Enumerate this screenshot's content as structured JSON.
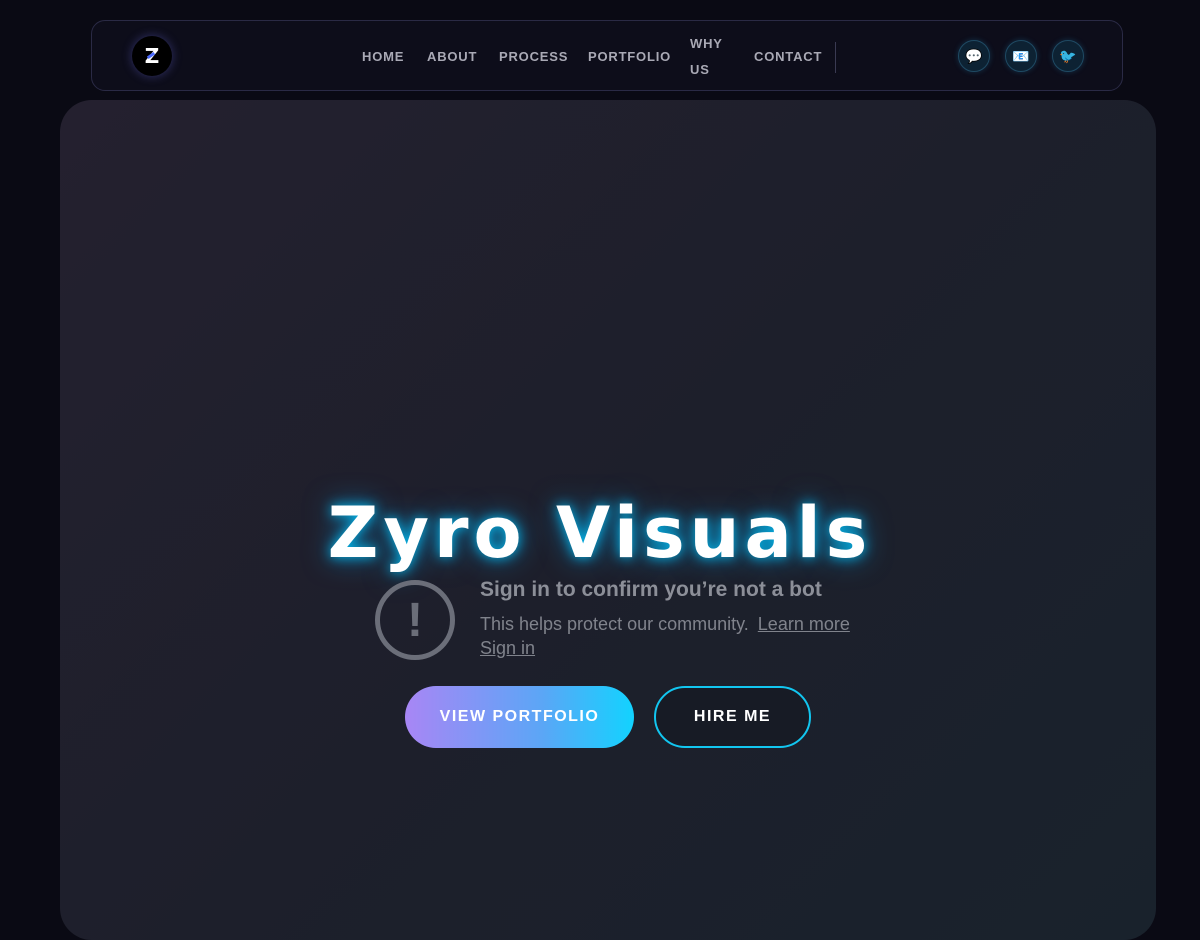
{
  "brand": {
    "logo_letter": "Z"
  },
  "nav": {
    "items": [
      {
        "label": "HOME"
      },
      {
        "label": "ABOUT"
      },
      {
        "label": "PROCESS"
      },
      {
        "label": "PORTFOLIO"
      },
      {
        "label": "WHY US"
      },
      {
        "label": "CONTACT"
      }
    ]
  },
  "social": {
    "items": [
      {
        "icon": "chat-icon",
        "glyph": "💬"
      },
      {
        "icon": "email-icon",
        "glyph": "📧"
      },
      {
        "icon": "twitter-icon",
        "glyph": "🐦"
      }
    ]
  },
  "hero": {
    "title": "Zyro Visuals",
    "primary_button": "VIEW PORTFOLIO",
    "secondary_button": "HIRE ME"
  },
  "bot_notice": {
    "title": "Sign in to confirm you’re not a bot",
    "description": "This helps protect our community.",
    "learn_more": "Learn more",
    "sign_in": "Sign in"
  },
  "colors": {
    "background": "#0a0a14",
    "accent_cyan": "#12c6f0",
    "accent_purple": "#a886f5"
  }
}
